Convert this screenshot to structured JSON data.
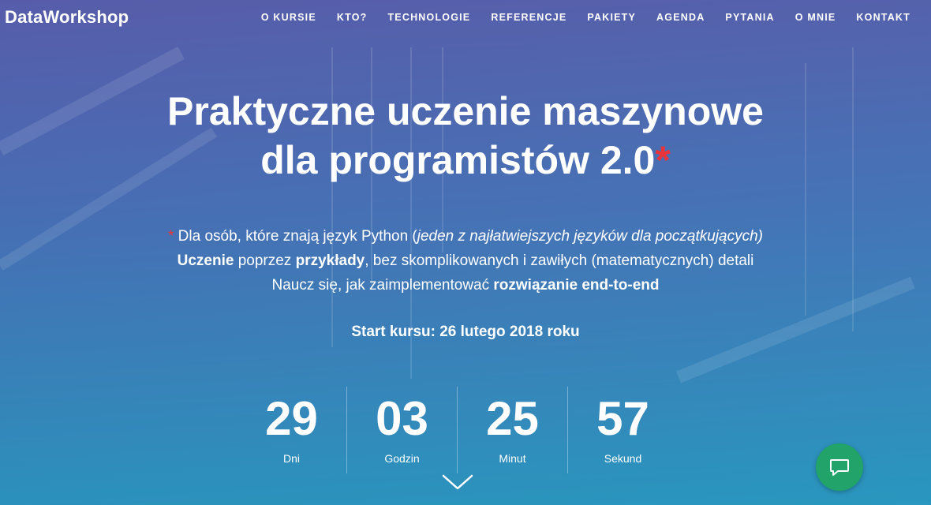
{
  "brand": "DataWorkshop",
  "nav": [
    "O KURSIE",
    "KTO?",
    "TECHNOLOGIE",
    "REFERENCJE",
    "PAKIETY",
    "AGENDA",
    "PYTANIA",
    "O MNIE",
    "KONTAKT"
  ],
  "hero": {
    "title_line1": "Praktyczne uczenie maszynowe",
    "title_line2": "dla programistów 2.0",
    "title_star": "*"
  },
  "desc": {
    "line1_star": "*",
    "line1_text": " Dla osób, które znają język Python (",
    "line1_italic": "jeden z najłatwiejszych języków dla początkujących)",
    "line2_bold1": "Uczenie",
    "line2_text1": " poprzez ",
    "line2_bold2": "przykłady",
    "line2_text2": ", bez skomplikowanych i zawiłych (matematycznych) detali",
    "line3_text": "Naucz się, jak zaimplementować ",
    "line3_bold": "rozwiązanie end-to-end"
  },
  "start": "Start kursu: 26 lutego 2018 roku",
  "countdown": [
    {
      "value": "29",
      "label": "Dni"
    },
    {
      "value": "03",
      "label": "Godzin"
    },
    {
      "value": "25",
      "label": "Minut"
    },
    {
      "value": "57",
      "label": "Sekund"
    }
  ],
  "colors": {
    "accent_red": "#e8353b",
    "chat_green": "#21a36a"
  },
  "icons": {
    "scroll": "chevron-down-icon",
    "chat": "chat-icon"
  }
}
